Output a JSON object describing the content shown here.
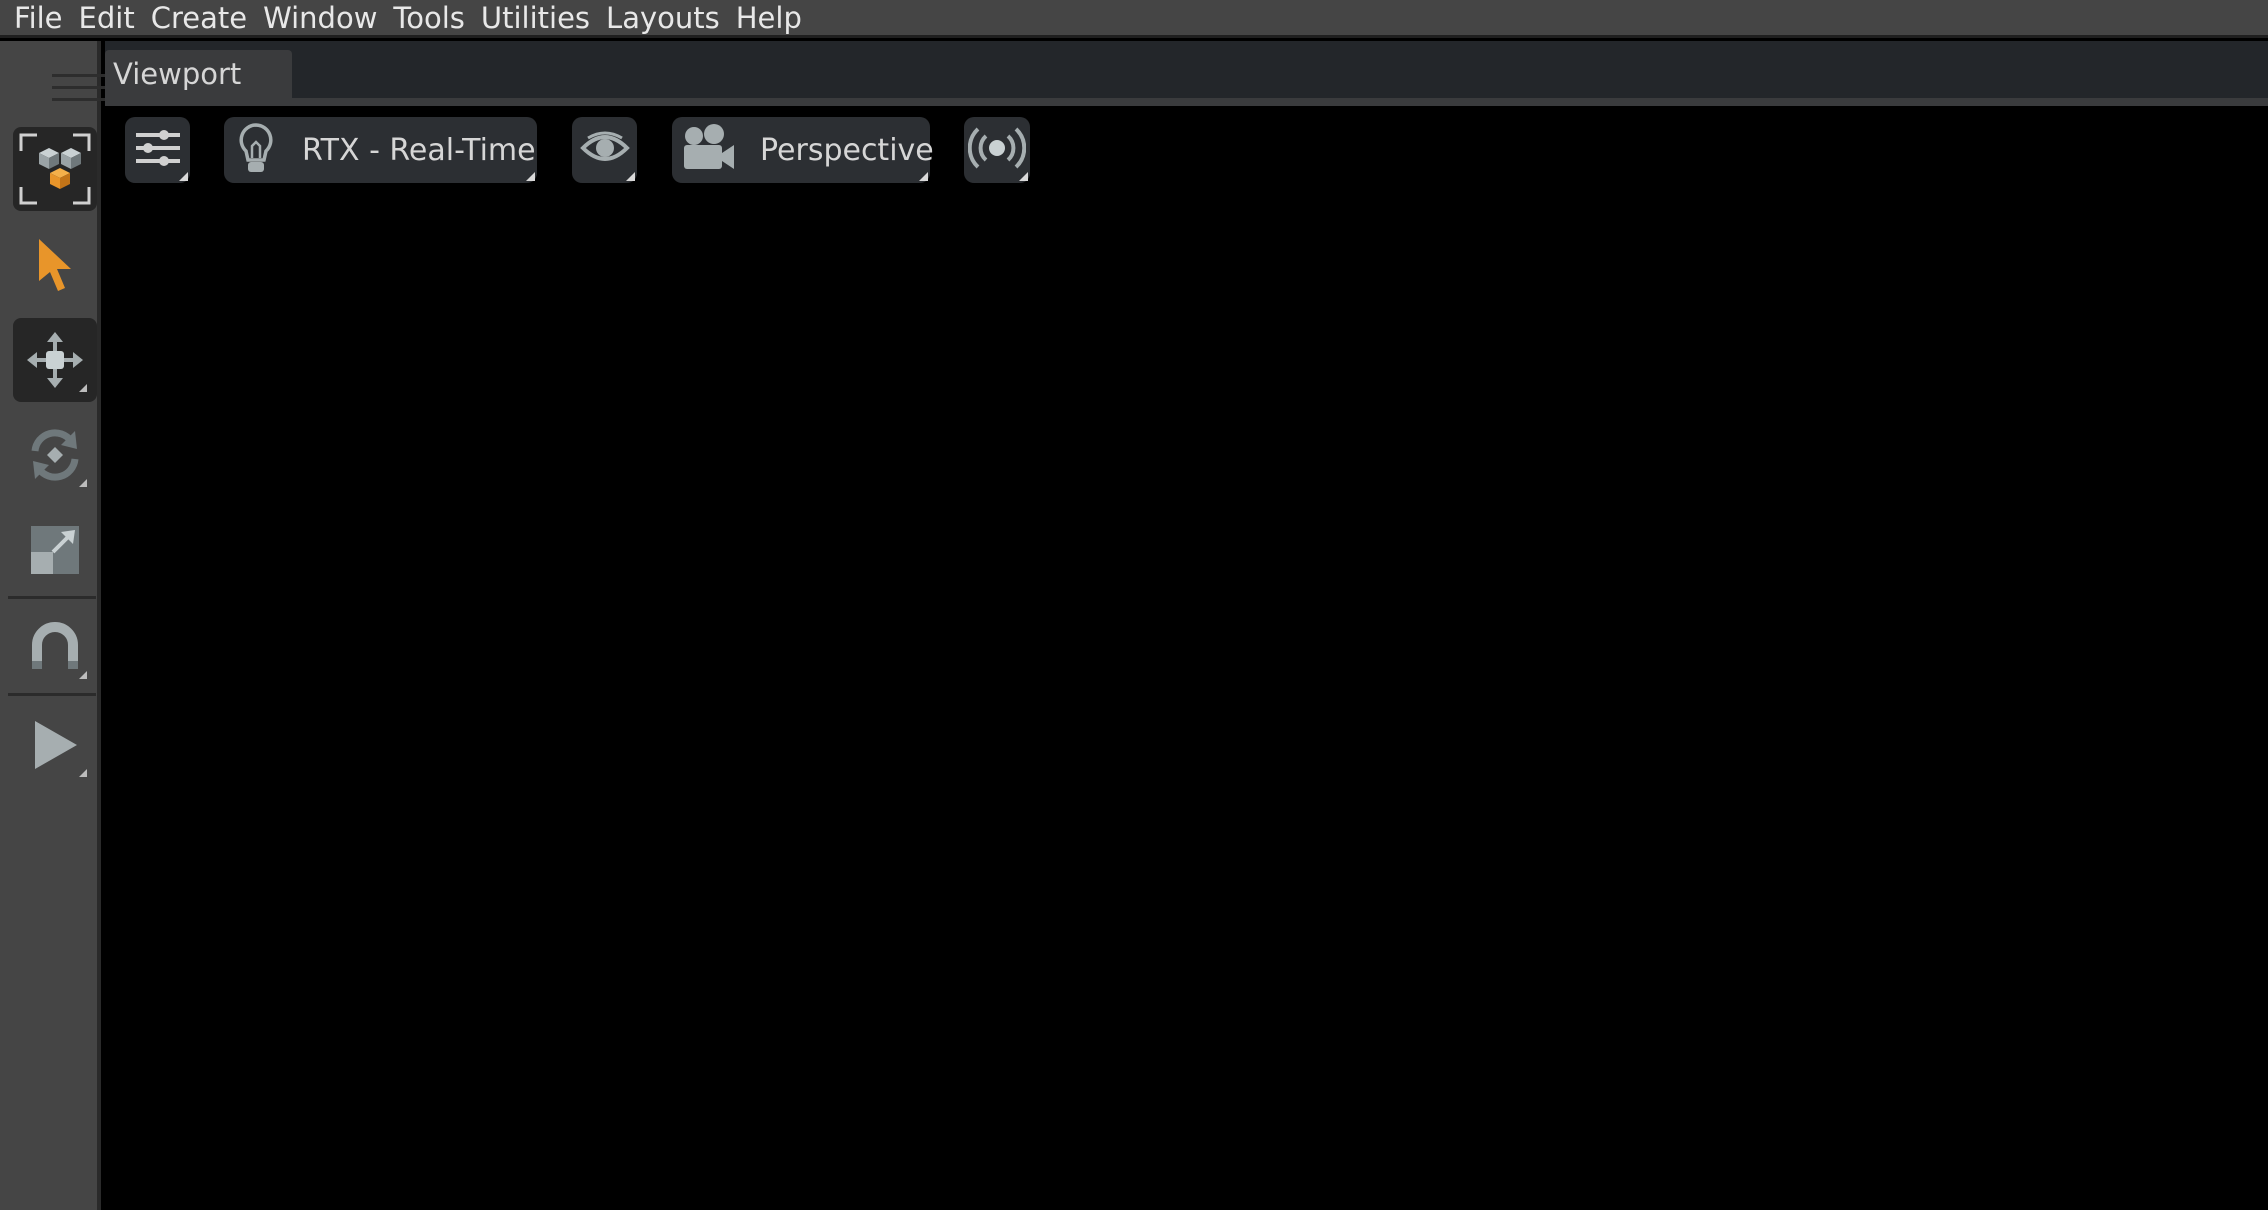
{
  "menubar": {
    "items": [
      {
        "label": "File"
      },
      {
        "label": "Edit"
      },
      {
        "label": "Create"
      },
      {
        "label": "Window"
      },
      {
        "label": "Tools"
      },
      {
        "label": "Utilities"
      },
      {
        "label": "Layouts"
      },
      {
        "label": "Help"
      }
    ]
  },
  "viewport": {
    "tab_label": "Viewport",
    "toolbar": {
      "renderer_label": "RTX - Real-Time",
      "camera_label": "Perspective"
    }
  },
  "colors": {
    "accent": "#e8952a",
    "menubar_bg": "#454545",
    "viewport_bg": "#000000"
  },
  "left_toolbar": {
    "tools": [
      {
        "icon": "select-mode-icon",
        "active": true
      },
      {
        "icon": "cursor-arrow-icon",
        "active": false
      },
      {
        "icon": "move-icon",
        "active": true
      },
      {
        "icon": "rotate-icon",
        "active": false
      },
      {
        "icon": "scale-icon",
        "active": false
      },
      {
        "icon": "magnet-snap-icon",
        "active": false
      },
      {
        "icon": "play-icon",
        "active": false
      }
    ]
  }
}
